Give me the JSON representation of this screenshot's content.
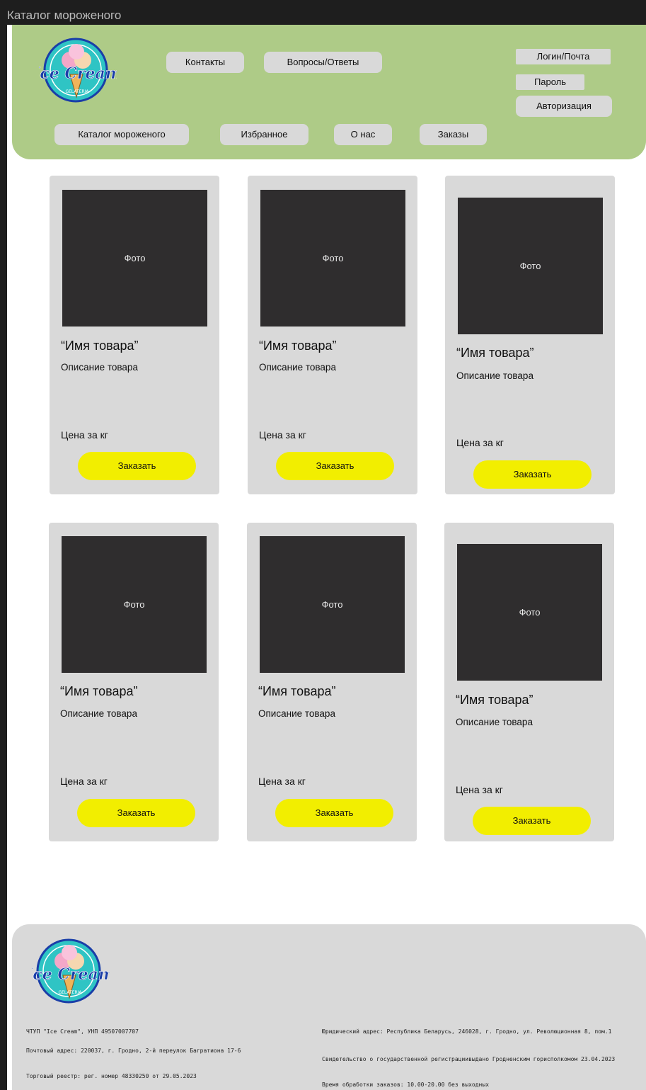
{
  "window": {
    "title": "Каталог мороженого"
  },
  "logo": {
    "main": "Ice Cream",
    "sub": "GELATERIA"
  },
  "nav_top": {
    "contacts": "Контакты",
    "faq": "Вопросы/Ответы"
  },
  "nav_bottom": {
    "catalog": "Каталог мороженого",
    "favorites": "Избранное",
    "about": "О нас",
    "orders": "Заказы"
  },
  "auth": {
    "login": "Логин/Почта",
    "password": "Пароль",
    "submit": "Авторизация"
  },
  "cards": [
    {
      "photo": "Фото",
      "name": "“Имя товара”",
      "desc": "Описание товара",
      "price": "Цена за кг",
      "order": "Заказать"
    },
    {
      "photo": "Фото",
      "name": "“Имя товара”",
      "desc": "Описание товара",
      "price": "Цена за кг",
      "order": "Заказать"
    },
    {
      "photo": "Фото",
      "name": "“Имя товара”",
      "desc": "Описание товара",
      "price": "Цена за кг",
      "order": "Заказать"
    },
    {
      "photo": "Фото",
      "name": "“Имя товара”",
      "desc": "Описание товара",
      "price": "Цена за кг",
      "order": "Заказать"
    },
    {
      "photo": "Фото",
      "name": "“Имя товара”",
      "desc": "Описание товара",
      "price": "Цена за кг",
      "order": "Заказать"
    },
    {
      "photo": "Фото",
      "name": "“Имя товара”",
      "desc": "Описание товара",
      "price": "Цена за кг",
      "order": "Заказать"
    }
  ],
  "footer": {
    "company": "ЧТУП \"Ice Cream\", УНП 49507007707",
    "postal": "Почтовый адрес: 220037, г. Гродно, 2-й переулок Багратиона 17-6",
    "registry": "Торговый реестр: рег. номер 48330250 от 29.05.2023",
    "legal": "Юридический адрес: Республика Беларусь, 246028, г. Гродно, ул. Революционная 8, пом.1",
    "certificate": "Свидетельство о государственной регистрациивыдано Гродненским горисполкомом 23.04.2023",
    "hours": "Время обработки заказов: 10.00-20.00 без выходных"
  },
  "colors": {
    "header_bg": "#aecb87",
    "card_bg": "#d9d9d9",
    "photo_bg": "#2f2d2e",
    "order_button": "#f2ee00",
    "logo_circle": "#2fc4c4",
    "logo_text": "#1a3ea8"
  }
}
